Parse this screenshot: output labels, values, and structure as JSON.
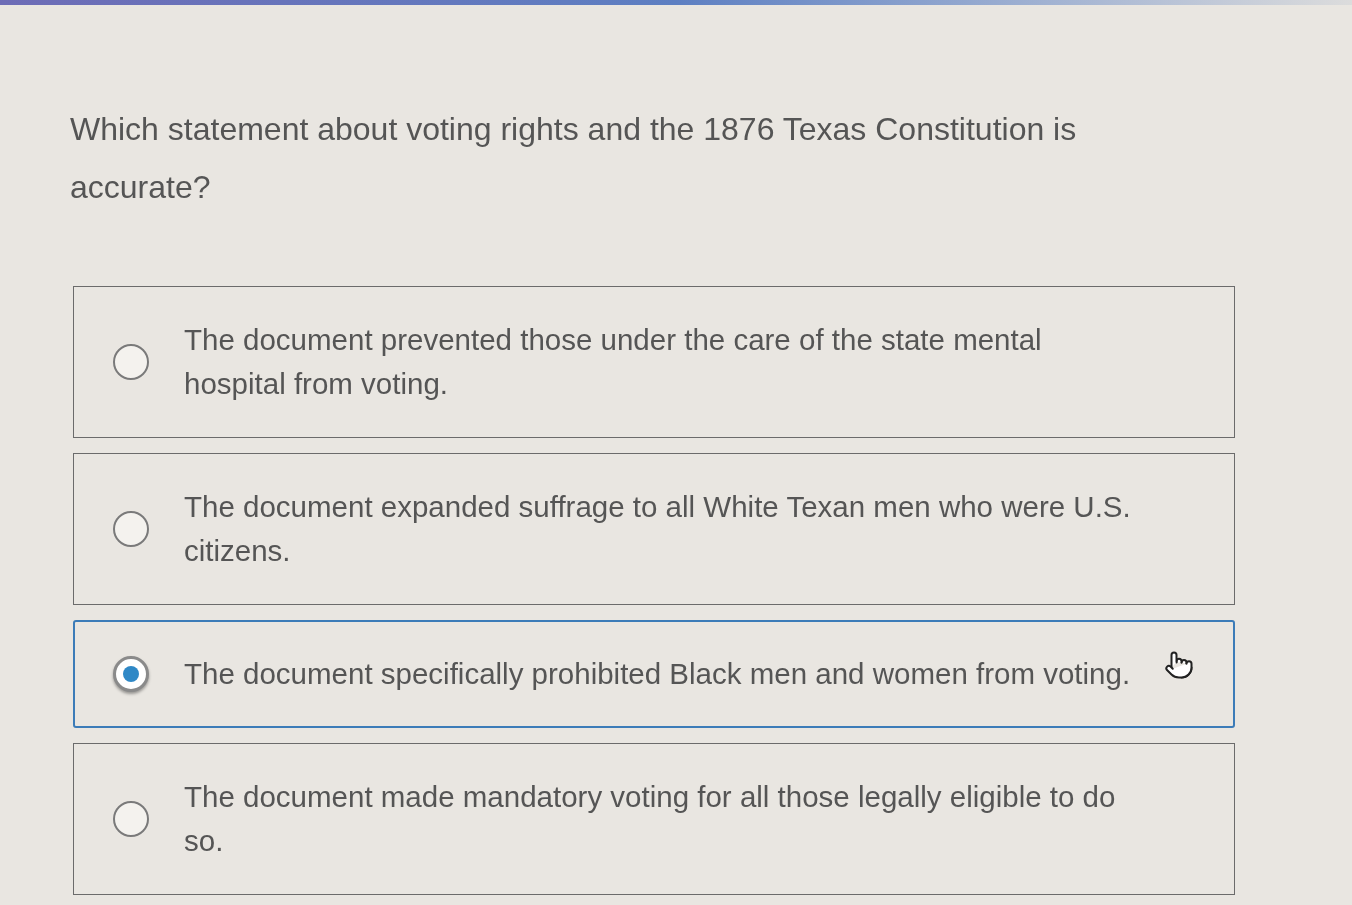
{
  "question": "Which statement about voting rights and the 1876 Texas Constitution is accurate?",
  "options": [
    {
      "text": "The document prevented those under the care of the state mental hospital from voting.",
      "selected": false
    },
    {
      "text": "The document expanded suffrage to all White Texan men who were U.S. citizens.",
      "selected": false
    },
    {
      "text": "The document specifically prohibited Black men and women from voting.",
      "selected": true
    },
    {
      "text": "The document made mandatory voting for all those legally eligible to do so.",
      "selected": false
    }
  ]
}
